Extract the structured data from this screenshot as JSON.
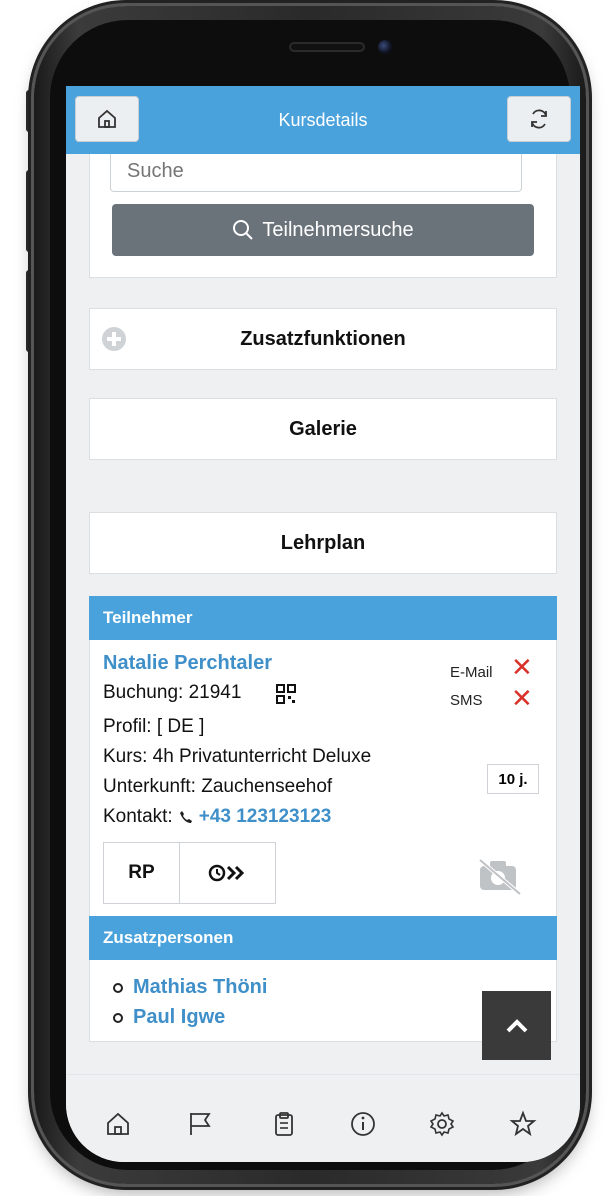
{
  "header": {
    "title": "Kursdetails",
    "home_icon": "home-icon",
    "refresh_icon": "refresh-icon"
  },
  "search": {
    "placeholder": "Suche",
    "button_label": "Teilnehmersuche"
  },
  "sections": {
    "extra_functions": "Zusatzfunktionen",
    "gallery": "Galerie",
    "curriculum": "Lehrplan"
  },
  "participants": {
    "heading": "Teilnehmer",
    "name": "Natalie Perchtaler",
    "booking_label": "Buchung: 21941",
    "profile": "Profil: [ DE ]",
    "course": "Kurs: 4h Privatunterricht Deluxe",
    "accommodation": "Unterkunft: Zauchenseehof",
    "contact_label": "Kontakt:",
    "phone": "+43 123123123",
    "email_label": "E-Mail",
    "sms_label": "SMS",
    "age_badge": "10 j.",
    "tab_rp": "RP",
    "email_status": "not sent",
    "sms_status": "not sent"
  },
  "additional_persons": {
    "heading": "Zusatzpersonen",
    "items": [
      "Mathias Thöni",
      "Paul Igwe"
    ]
  },
  "bottom_nav": [
    "home-icon",
    "flag-icon",
    "clipboard-icon",
    "info-icon",
    "settings-icon",
    "star-icon"
  ],
  "colors": {
    "primary": "#4aa2dc",
    "link": "#3f8fc9",
    "danger": "#d9322a",
    "button_dark": "#6a727a"
  }
}
